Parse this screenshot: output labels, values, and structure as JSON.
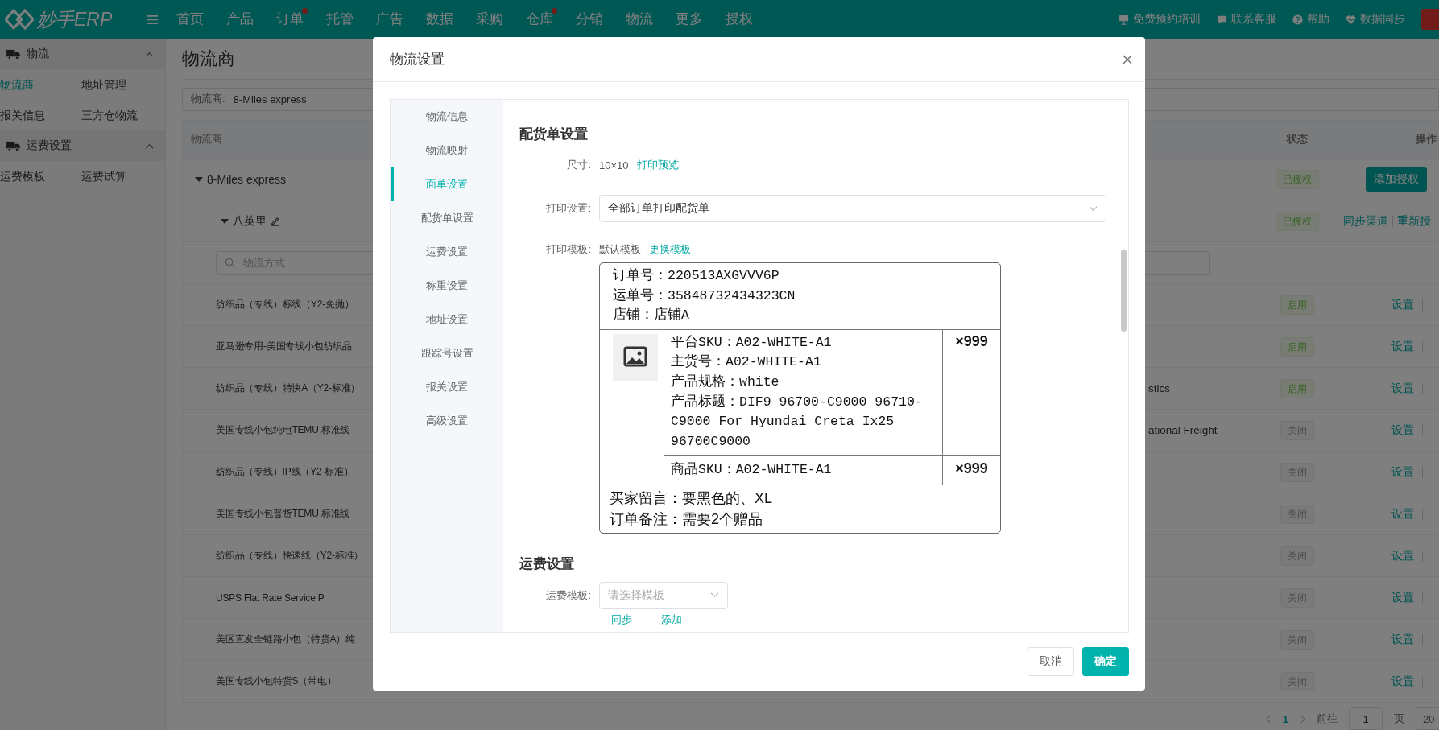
{
  "topbar": {
    "logo": "妙手ERP",
    "nav": [
      {
        "label": "首页",
        "badge": false
      },
      {
        "label": "产品",
        "badge": false
      },
      {
        "label": "订单",
        "badge": true
      },
      {
        "label": "托管",
        "badge": false
      },
      {
        "label": "广告",
        "badge": false
      },
      {
        "label": "数据",
        "badge": false
      },
      {
        "label": "采购",
        "badge": false
      },
      {
        "label": "仓库",
        "badge": true
      },
      {
        "label": "分销",
        "badge": false
      },
      {
        "label": "物流",
        "badge": false
      },
      {
        "label": "更多",
        "badge": false
      },
      {
        "label": "授权",
        "badge": false
      }
    ],
    "tools": [
      {
        "label": "免费预约培训",
        "kind": "board"
      },
      {
        "label": "联系客服",
        "kind": "chat"
      },
      {
        "label": "帮助",
        "kind": "help"
      },
      {
        "label": "数据同步",
        "kind": "heart"
      }
    ]
  },
  "sidebar": {
    "groups": [
      {
        "title": "物流",
        "expanded": true,
        "items": [
          {
            "label": "物流商",
            "selected": true
          },
          {
            "label": "地址管理",
            "selected": false
          },
          {
            "label": "报关信息",
            "selected": false
          },
          {
            "label": "三方仓物流",
            "selected": false
          }
        ]
      },
      {
        "title": "运费设置",
        "expanded": true,
        "items": [
          {
            "label": "运费模板",
            "selected": false
          },
          {
            "label": "运费试算",
            "selected": false
          }
        ]
      }
    ]
  },
  "page": {
    "title": "物流商",
    "filter": {
      "label": "物流商:",
      "value": "8-Miles express"
    },
    "table": {
      "columns": [
        "物流商",
        "状态",
        "操作"
      ],
      "provider": {
        "name": "8-Miles express",
        "expanded": true,
        "status": {
          "label": "已授权",
          "kind": "success"
        },
        "action": "添加授权"
      },
      "account": {
        "name": "八英里",
        "expanded": true,
        "status": {
          "label": "已授权",
          "kind": "success"
        },
        "actions": [
          "同步渠道",
          "重新授"
        ]
      },
      "search": {
        "placeholder": "物流方式"
      },
      "rows": [
        {
          "name": "纺织品（专线）标线（Y2-免抛）",
          "status": {
            "label": "启用",
            "kind": "success"
          },
          "action": "设置"
        },
        {
          "name": "亚马逊专用-美国专线小包纺织品",
          "status": {
            "label": "启用",
            "kind": "success"
          },
          "action": "设置"
        },
        {
          "name": "纺织品（专线）特快A（Y2-标准）",
          "column_2": "stics",
          "status": {
            "label": "启用",
            "kind": "success"
          },
          "action": "设置"
        },
        {
          "name": "美国专线小包纯电TEMU 标准线",
          "column_2": "ational Freight",
          "status": {
            "label": "关闭",
            "kind": "info"
          },
          "action": "设置"
        },
        {
          "name": "纺织品（专线）IP线（Y2-标准）",
          "status": {
            "label": "关闭",
            "kind": "info"
          },
          "action": "设置"
        },
        {
          "name": "美国专线小包普货TEMU 标准线",
          "status": {
            "label": "关闭",
            "kind": "info"
          },
          "action": "设置"
        },
        {
          "name": "纺织品（专线）快速线（Y2-标准）",
          "status": {
            "label": "关闭",
            "kind": "info"
          },
          "action": "设置"
        },
        {
          "name": "USPS Flat Rate Service P",
          "status": {
            "label": "关闭",
            "kind": "info"
          },
          "action": "设置"
        },
        {
          "name": "美区直发全链路小包（特货A）纯",
          "status": {
            "label": "关闭",
            "kind": "info"
          },
          "action": "设置"
        },
        {
          "name": "美国专线小包特货S（带电）",
          "status": {
            "label": "关闭",
            "kind": "info"
          },
          "action": "设置"
        }
      ]
    },
    "pagination": {
      "pages": [
        {
          "label": "1",
          "selected": true
        }
      ],
      "goto_label": "前往",
      "page_value": "1",
      "page_suffix": "页",
      "size": "20"
    }
  },
  "modal": {
    "title": "物流设置",
    "nav": [
      {
        "label": "物流信息",
        "selected": false
      },
      {
        "label": "物流映射",
        "selected": false
      },
      {
        "label": "面单设置",
        "selected": true
      },
      {
        "label": "配货单设置",
        "selected": false
      },
      {
        "label": "运费设置",
        "selected": false
      },
      {
        "label": "称重设置",
        "selected": false
      },
      {
        "label": "地址设置",
        "selected": false
      },
      {
        "label": "跟踪号设置",
        "selected": false
      },
      {
        "label": "报关设置",
        "selected": false
      },
      {
        "label": "高级设置",
        "selected": false
      }
    ],
    "slip": {
      "heading": "配货单设置",
      "size": {
        "label": "尺寸:",
        "value": "10×10",
        "link": "打印预览"
      },
      "print": {
        "label": "打印设置:",
        "value": "全部订单打印配货单"
      },
      "template": {
        "label": "打印模板:",
        "value": "默认模板",
        "link": "更换模板",
        "preview": {
          "header_lines": [
            "订单号：220513AXGVVV6P",
            "运单号：35848732434323CN",
            "店铺：店铺A"
          ],
          "items": [
            {
              "lines": [
                "平台SKU：A02-WHITE-A1",
                "主货号：A02-WHITE-A1",
                "产品规格：white",
                "产品标题：DIF9 96700-C9000 96710-C9000 For Hyundai Creta Ix25 96700C9000"
              ],
              "qty": "×999"
            },
            {
              "lines": [
                "商品SKU：A02-WHITE-A1"
              ],
              "qty": "×999"
            }
          ],
          "notes": [
            "买家留言：要黑色的、XL",
            "订单备注：需要2个赠品"
          ]
        }
      }
    },
    "freight": {
      "heading": "运费设置",
      "template": {
        "label": "运费模板:",
        "placeholder": "请选择模板"
      },
      "links": [
        "同步",
        "添加"
      ]
    },
    "buttons": [
      {
        "label": "取消",
        "kind": "default"
      },
      {
        "label": "确定",
        "kind": "primary"
      }
    ]
  }
}
